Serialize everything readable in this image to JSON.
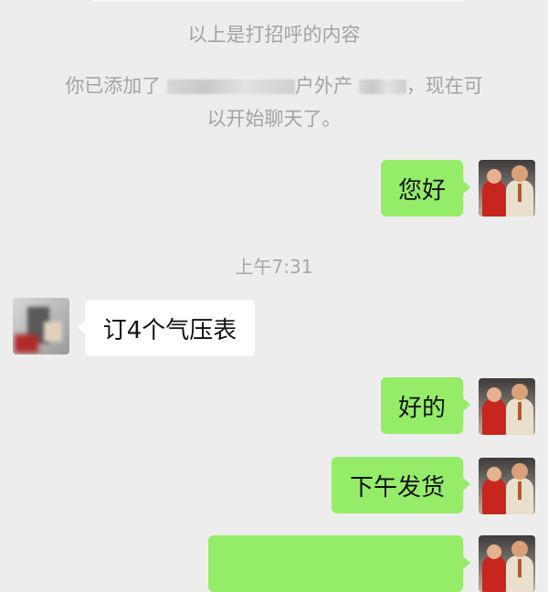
{
  "system": {
    "greeting_note": "以上是打招呼的内容",
    "added_prefix": "你已添加了",
    "added_fragment": "户外产",
    "added_suffix": "，现在可",
    "added_line2": "以开始聊天了。"
  },
  "timestamp": "上午7:31",
  "messages": [
    {
      "from": "self",
      "text": "您好"
    },
    {
      "from": "other",
      "text": "订4个气压表"
    },
    {
      "from": "self",
      "text": "好的"
    },
    {
      "from": "self",
      "text": "下午发货"
    },
    {
      "from": "self",
      "text": ""
    }
  ],
  "colors": {
    "background": "#ededed",
    "outgoing_bubble": "#95ec69",
    "incoming_bubble": "#ffffff",
    "system_text": "#a3a3a3"
  }
}
